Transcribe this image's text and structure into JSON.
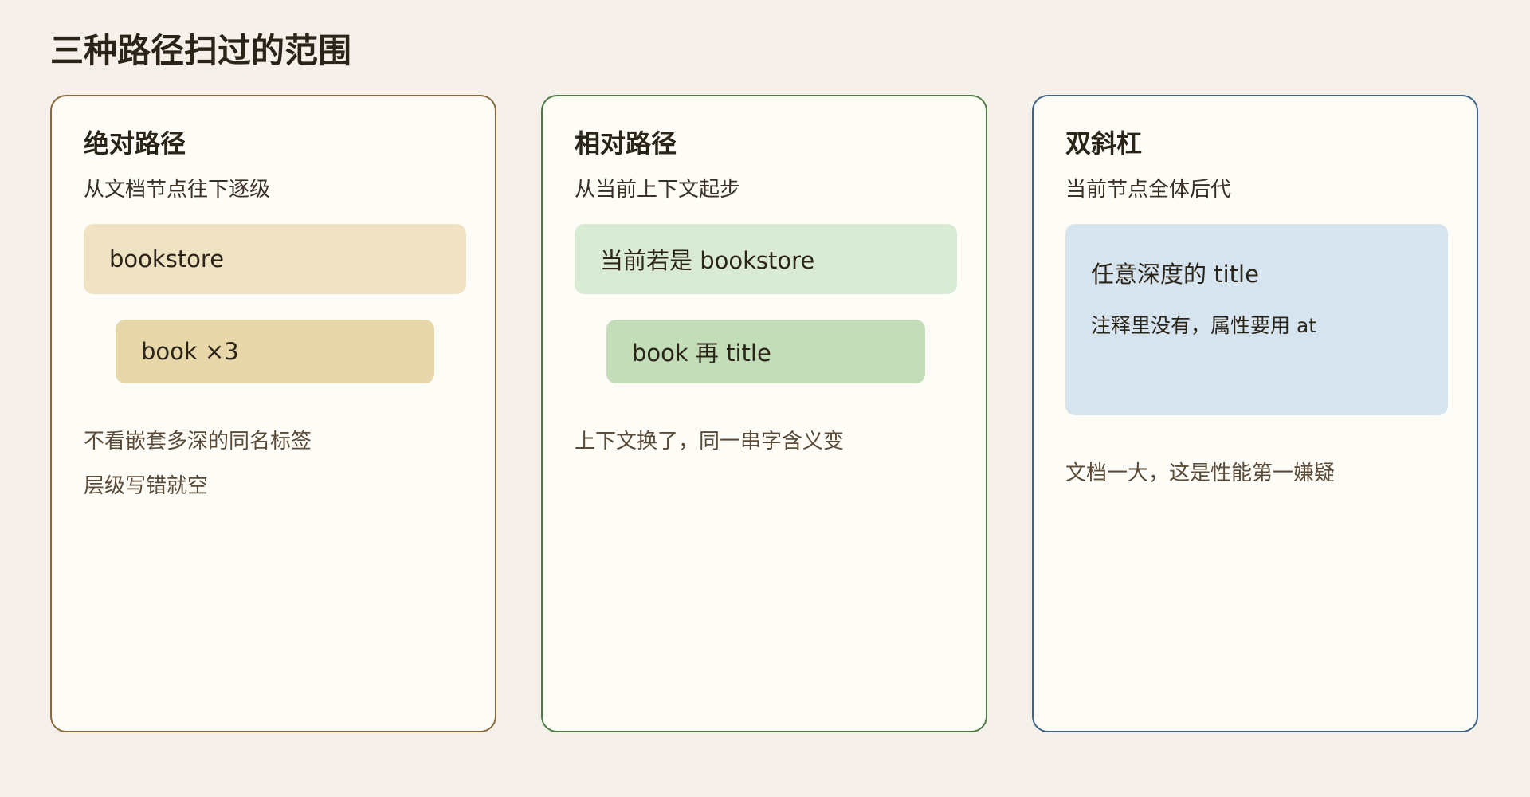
{
  "page": {
    "title": "三种路径扫过的范围"
  },
  "colors": {
    "background": "#f5f1ea",
    "panel_fill": "#fdfcf7",
    "absolute_border": "#8a6a3d",
    "relative_border": "#4f7a46",
    "descendant_border": "#3f6486",
    "absolute_outer_fill": "#efe3c4",
    "absolute_inner_fill": "#e8d7a9",
    "relative_outer_fill": "#d9ead5",
    "relative_inner_fill": "#c4ddb9",
    "descendant_fill": "#d6e4ef"
  },
  "panels": [
    {
      "title": "绝对路径",
      "subtitle": "从文档节点往下逐级",
      "outer_box": "bookstore",
      "inner_box": "book ×3",
      "notes": [
        "不看嵌套多深的同名标签",
        "层级写错就空"
      ]
    },
    {
      "title": "相对路径",
      "subtitle": "从当前上下文起步",
      "outer_box": "当前若是 bookstore",
      "inner_box": "book 再 title",
      "notes": [
        "上下文换了，同一串字含义变"
      ]
    },
    {
      "title": "双斜杠",
      "subtitle": "当前节点全体后代",
      "box_line1": "任意深度的 title",
      "box_line2": "注释里没有，属性要用 at",
      "notes": [
        "文档一大，这是性能第一嫌疑"
      ]
    }
  ]
}
